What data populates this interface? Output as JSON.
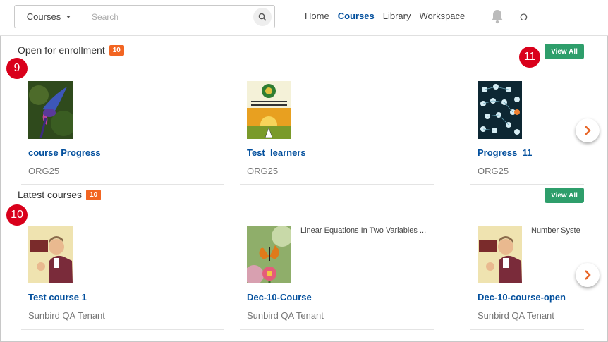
{
  "header": {
    "search": {
      "type_label": "Courses",
      "placeholder": "Search"
    },
    "nav": [
      {
        "label": "Home"
      },
      {
        "label": "Courses",
        "active": true
      },
      {
        "label": "Library"
      },
      {
        "label": "Workspace"
      }
    ],
    "user_initial": "O",
    "icons": [
      "search-icon",
      "bell-icon",
      "chevron-down-icon"
    ]
  },
  "sections": [
    {
      "title": "Open for enrollment",
      "count": "10",
      "view_all": "View All",
      "marker": "9",
      "cards": [
        {
          "title": "course Progress",
          "subtitle": "ORG25",
          "description": ""
        },
        {
          "title": "Test_learners",
          "subtitle": "ORG25",
          "description": ""
        },
        {
          "title": "Progress_11",
          "subtitle": "ORG25",
          "description": ""
        }
      ]
    },
    {
      "title": "Latest courses",
      "count": "10",
      "view_all": "View All",
      "marker": "10",
      "cards": [
        {
          "title": "Test course 1",
          "subtitle": "Sunbird QA Tenant",
          "description": ""
        },
        {
          "title": "Dec-10-Course",
          "subtitle": "Sunbird QA Tenant",
          "description": "Linear Equations In Two Variables ..."
        },
        {
          "title": "Dec-10-course-open",
          "subtitle": "Sunbird QA Tenant",
          "description": "Number Syste"
        }
      ]
    }
  ],
  "view_all_marker": "11",
  "colors": {
    "accent": "#024f9d",
    "badge": "#f26522",
    "view_all": "#2e9e6b",
    "marker": "#d9001b"
  }
}
